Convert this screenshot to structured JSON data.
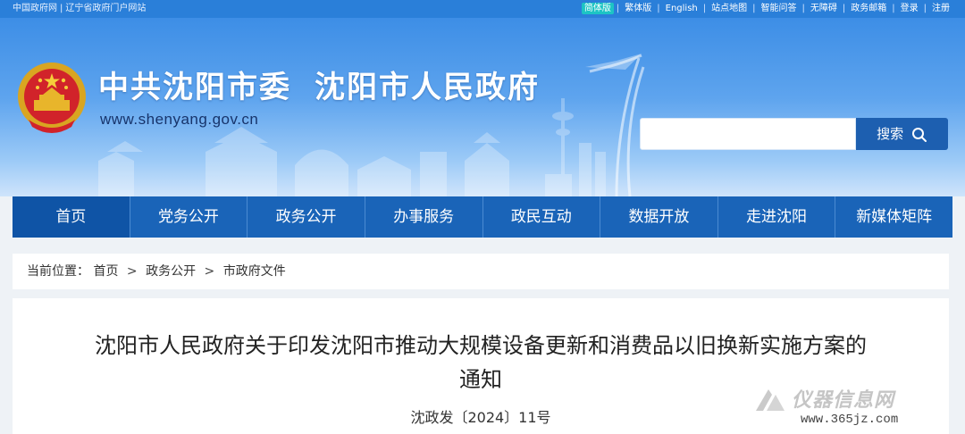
{
  "topbar": {
    "left_links": [
      "中国政府网",
      "辽宁省政府门户网站"
    ],
    "right_links": [
      "简体版",
      "繁体版",
      "English",
      "站点地图",
      "智能问答",
      "无障碍",
      "政务邮箱",
      "登录",
      "注册"
    ]
  },
  "header": {
    "title_part1": "中共沈阳市委",
    "title_part2": "沈阳市人民政府",
    "domain": "www.shenyang.gov.cn",
    "search_button": "搜索",
    "search_placeholder": ""
  },
  "nav": {
    "items": [
      "首页",
      "党务公开",
      "政务公开",
      "办事服务",
      "政民互动",
      "数据开放",
      "走进沈阳",
      "新媒体矩阵"
    ]
  },
  "breadcrumb": {
    "label": "当前位置：",
    "items": [
      "首页",
      "政务公开",
      "市政府文件"
    ],
    "separator": ">"
  },
  "article": {
    "title_line1": "沈阳市人民政府关于印发沈阳市推动大规模设备更新和消费品以旧换新实施方案的",
    "title_line2": "通知",
    "doc_number": "沈政发〔2024〕11号"
  },
  "watermark": {
    "brand": "仪器信息网",
    "url": "www.365jz.com"
  },
  "colors": {
    "topbar": "#2a7fd9",
    "nav": "#1a64b8",
    "search_button": "#1d5fb0",
    "active_lang": "#1dc4c4"
  }
}
